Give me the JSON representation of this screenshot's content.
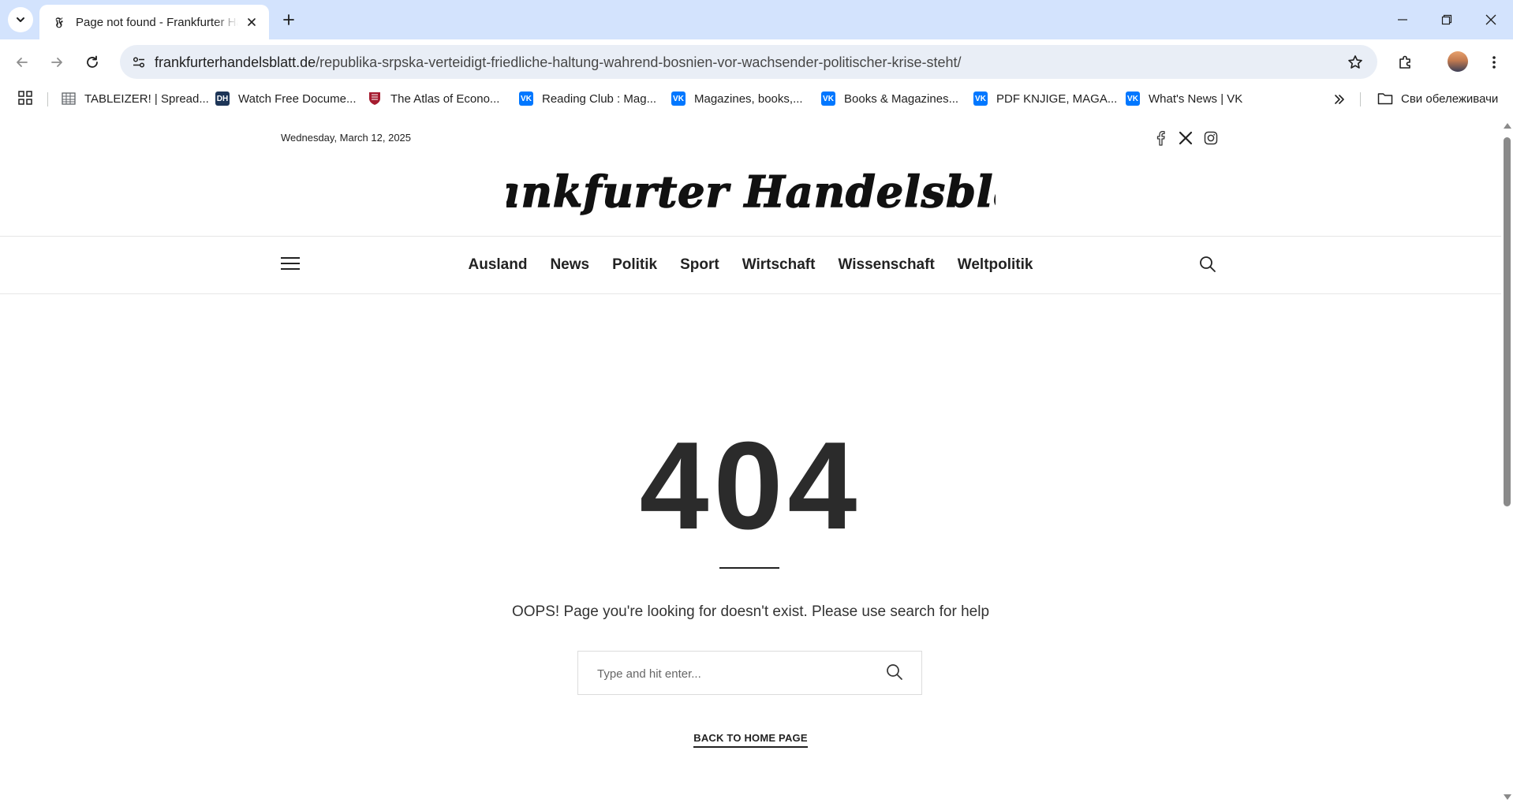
{
  "browser": {
    "tab": {
      "title": "Page not found - Frankfurter Handelsblatt",
      "favicon": "𝔉"
    },
    "address": {
      "host": "frankfurterhandelsblatt.de",
      "path": "/republika-srpska-verteidigt-friedliche-haltung-wahrend-bosnien-vor-wachsender-politischer-krise-steht/"
    },
    "bookmarks": [
      {
        "label": "TABLEIZER! | Spread...",
        "icon": "table-icon"
      },
      {
        "label": "Watch Free Docume...",
        "icon": "dh-icon",
        "badge": "DH"
      },
      {
        "label": "The Atlas of Econo...",
        "icon": "shield-icon"
      },
      {
        "label": "Reading Club : Mag...",
        "icon": "vk-icon"
      },
      {
        "label": "Magazines, books,...",
        "icon": "vk-icon"
      },
      {
        "label": "Books & Magazines...",
        "icon": "vk-icon"
      },
      {
        "label": "PDF KNJIGE, MAGA...",
        "icon": "vk-icon"
      },
      {
        "label": "What's News | VK",
        "icon": "vk-icon"
      }
    ],
    "bookmarks_folder": "Сви обележивачи"
  },
  "page": {
    "date": "Wednesday, March 12, 2025",
    "masthead": "Frankfurter Handelsblatt",
    "nav": [
      "Ausland",
      "News",
      "Politik",
      "Sport",
      "Wirtschaft",
      "Wissenschaft",
      "Weltpolitik"
    ],
    "error_code": "404",
    "message": "OOPS! Page you're looking for doesn't exist. Please use search for help",
    "search_placeholder": "Type and hit enter...",
    "back_home": "BACK TO HOME PAGE"
  },
  "colors": {
    "tabstrip": "#d3e3fd",
    "omnibox": "#e9eef6",
    "vk_blue": "#0077ff",
    "text_dark": "#222222"
  }
}
